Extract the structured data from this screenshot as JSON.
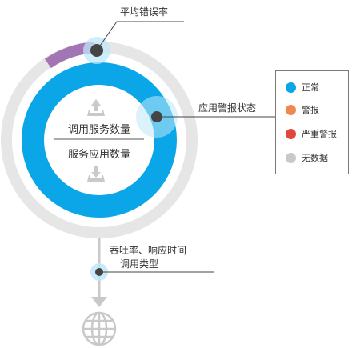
{
  "labels": {
    "avg_error_rate": "平均错误率",
    "app_alarm_status": "应用警报状态",
    "call_service_count": "调用服务数量",
    "service_app_count": "服务应用数量",
    "throughput_line1": "吞吐率、响应时间",
    "throughput_line2": "调用类型"
  },
  "legend": [
    {
      "label": "正常",
      "color": "#0aa6e8"
    },
    {
      "label": "警报",
      "color": "#f0884f"
    },
    {
      "label": "严重警报",
      "color": "#e0473a"
    },
    {
      "label": "无数据",
      "color": "#c9c9c9"
    }
  ],
  "colors": {
    "main_blue": "#0aa6e8",
    "outer_ring": "#e6e6e6",
    "error_arc": "#a276b5",
    "marker_dark": "#444444",
    "marker_halo": "#bfe7f8"
  },
  "icons": {
    "up_tray": "upload-tray-icon",
    "down_tray": "download-tray-icon",
    "globe": "globe-icon",
    "arrow": "arrow-down-icon"
  }
}
